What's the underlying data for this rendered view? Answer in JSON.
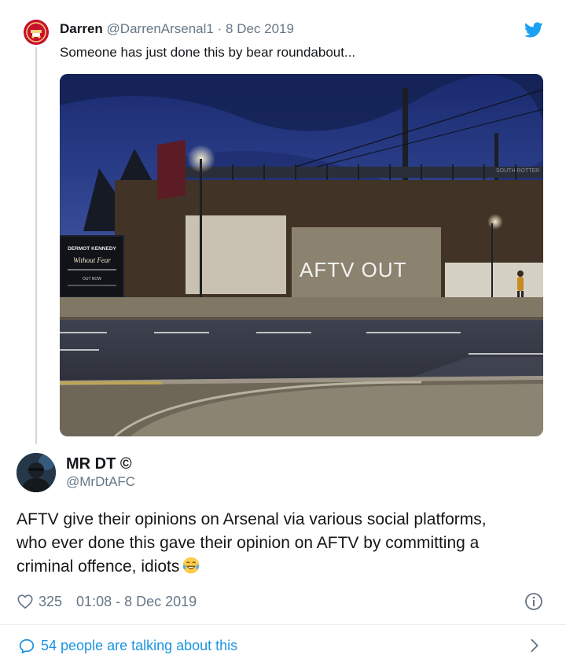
{
  "quoted_tweet": {
    "author_name": "Darren",
    "author_handle": "@DarrenArsenal1",
    "separator": "·",
    "date": "8 Dec 2019",
    "text": "Someone has just done this by bear roundabout...",
    "photo": {
      "wall_graffiti": "AFTV OUT",
      "billboard_title": "DERMOT KENNEDY",
      "billboard_signature": "Without Fear",
      "billboard_cta": "OUT NOW",
      "bridge_sign": "SOUTH ROTTER"
    }
  },
  "main_tweet": {
    "author_name": "MR DT ©",
    "author_handle": "@MrDtAFC",
    "text_lines": [
      "AFTV give their opinions on Arsenal via various social platforms,",
      "who ever done this gave their opinion on AFTV by committing a",
      "criminal offence, idiots"
    ],
    "emoji": "face-with-tears-of-joy",
    "like_count": "325",
    "timestamp": "01:08 - 8 Dec 2019"
  },
  "conversation_link": "54 people are talking about this",
  "colors": {
    "link_blue": "#1b95e0",
    "twitter_blue": "#1da1f2",
    "muted_gray": "#657786",
    "text_dark": "#14171a",
    "arsenal_red": "#c8102e"
  }
}
